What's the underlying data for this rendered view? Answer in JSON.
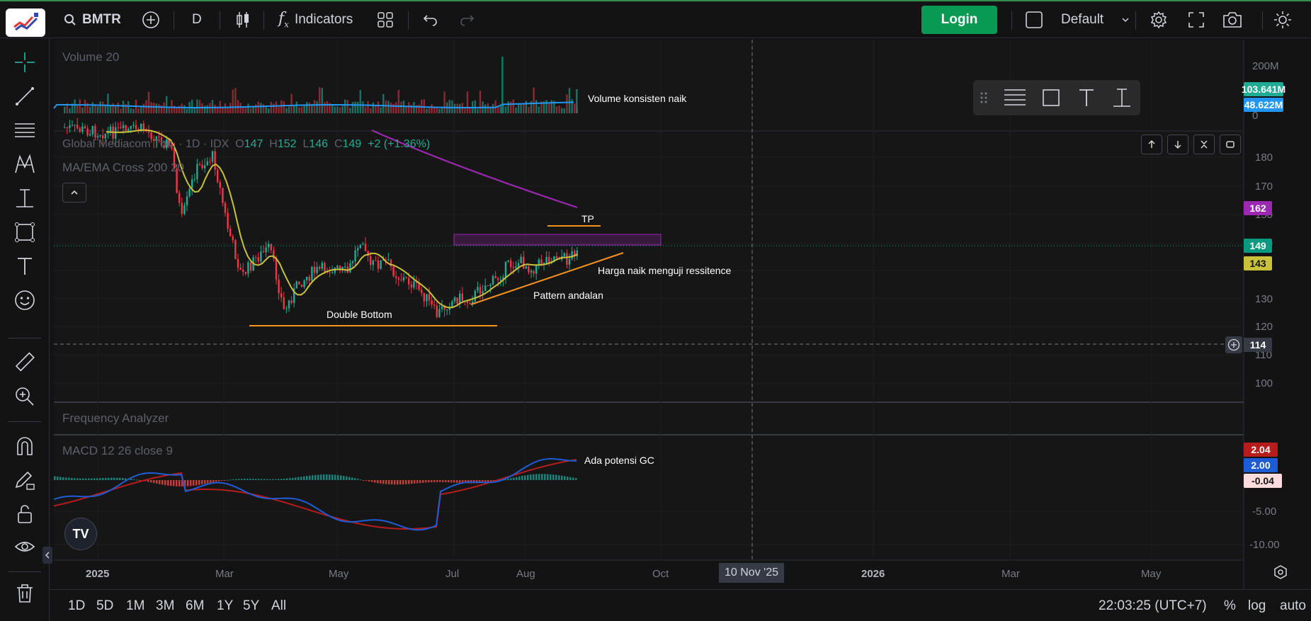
{
  "topbar": {
    "symbol": "BMTR",
    "interval": "D",
    "indicators_label": "Indicators",
    "login_label": "Login",
    "layout_label": "Default"
  },
  "legend": {
    "name": "Global Mediacom Tbk.",
    "interval": "1D",
    "exchange": "IDX",
    "o_label": "O",
    "o_value": "147",
    "h_label": "H",
    "h_value": "152",
    "l_label": "L",
    "l_value": "146",
    "c_label": "C",
    "c_value": "149",
    "change": "+2 (+1.36%)"
  },
  "panes": {
    "volume_label": "Volume 20",
    "ma_label": "MA/EMA Cross 200 20",
    "freq_label": "Frequency Analyzer",
    "macd_label": "MACD 12 26 close 9"
  },
  "annotations": {
    "volume": "Volume konsisten naik",
    "tp": "TP",
    "resistance": "Harga naik menguji ressitence",
    "pattern": "Pattern andalan",
    "double_bottom": "Double Bottom",
    "macd": "Ada potensi GC"
  },
  "price_axis": {
    "volume_ticks": [
      "200M",
      "0"
    ],
    "price_ticks": [
      "180",
      "170",
      "150",
      "140",
      "130",
      "120",
      "110",
      "100"
    ],
    "macd_ticks": [
      "-5.00",
      "-10.00"
    ]
  },
  "price_tags": {
    "vol_green": "103.641M",
    "vol_blue": "48.622M",
    "ma200": "162",
    "last": "149",
    "ma20": "143",
    "crosshair": "114",
    "macd_red": "2.04",
    "macd_blue": "2.00",
    "macd_hist": "-0.04"
  },
  "colors": {
    "up": "#22ab94",
    "down": "#f23645",
    "ma20": "#c9c13a",
    "ma200": "#9c27b0",
    "macd": "#1e5cd6",
    "signal": "#b71c1c",
    "annot_line": "#f7931a",
    "login": "#089953"
  },
  "time_axis": {
    "labels": [
      "2025",
      "Mar",
      "May",
      "Jul",
      "Aug",
      "Oct",
      "2026",
      "Mar",
      "May"
    ],
    "crosshair_date": "10 Nov '25"
  },
  "bottombar": {
    "ranges": [
      "1D",
      "5D",
      "1M",
      "3M",
      "6M",
      "1Y",
      "5Y",
      "All"
    ],
    "time": "22:03:25 (UTC+7)",
    "pct": "%",
    "log": "log",
    "auto": "auto"
  },
  "tv_logo_text": "TV"
}
